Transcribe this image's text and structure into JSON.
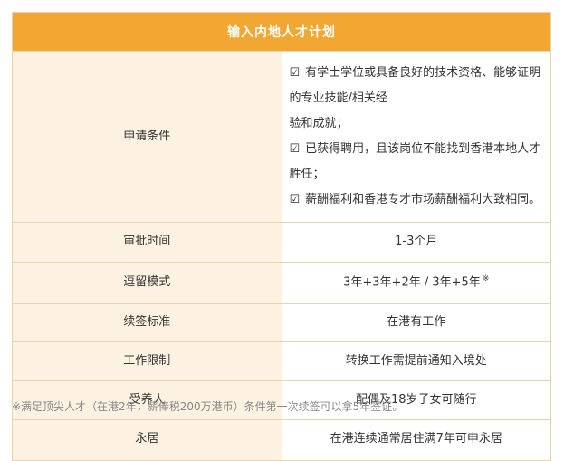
{
  "title": "输入内地人才计划",
  "rows": [
    {
      "label": "申请条件",
      "conditions": [
        "有学士学位或具备良好的技术资格、能够证明的专业技能/相关经",
        "验和成就；",
        "已获得聘用，且该岗位不能找到香港本地人才胜任；",
        "薪酬福利和香港专才市场薪酬福利大致相同。"
      ]
    },
    {
      "label": "审批时间",
      "value": "1-3个月"
    },
    {
      "label": "逗留模式",
      "value": "3年+3年+2年 / 3年+5年",
      "mark": "※"
    },
    {
      "label": "续签标准",
      "value": "在港有工作"
    },
    {
      "label": "工作限制",
      "value": "转换工作需提前通知入境处"
    },
    {
      "label": "受养人",
      "value": "配偶及18岁子女可随行"
    },
    {
      "label": "永居",
      "value": "在港连续通常居住满7年可申永居"
    }
  ],
  "checkbox_glyph": "☑",
  "footnote": "※满足顶尖人才（在港2年，薪俸税200万港币）条件第一次续签可以拿5年签证。"
}
